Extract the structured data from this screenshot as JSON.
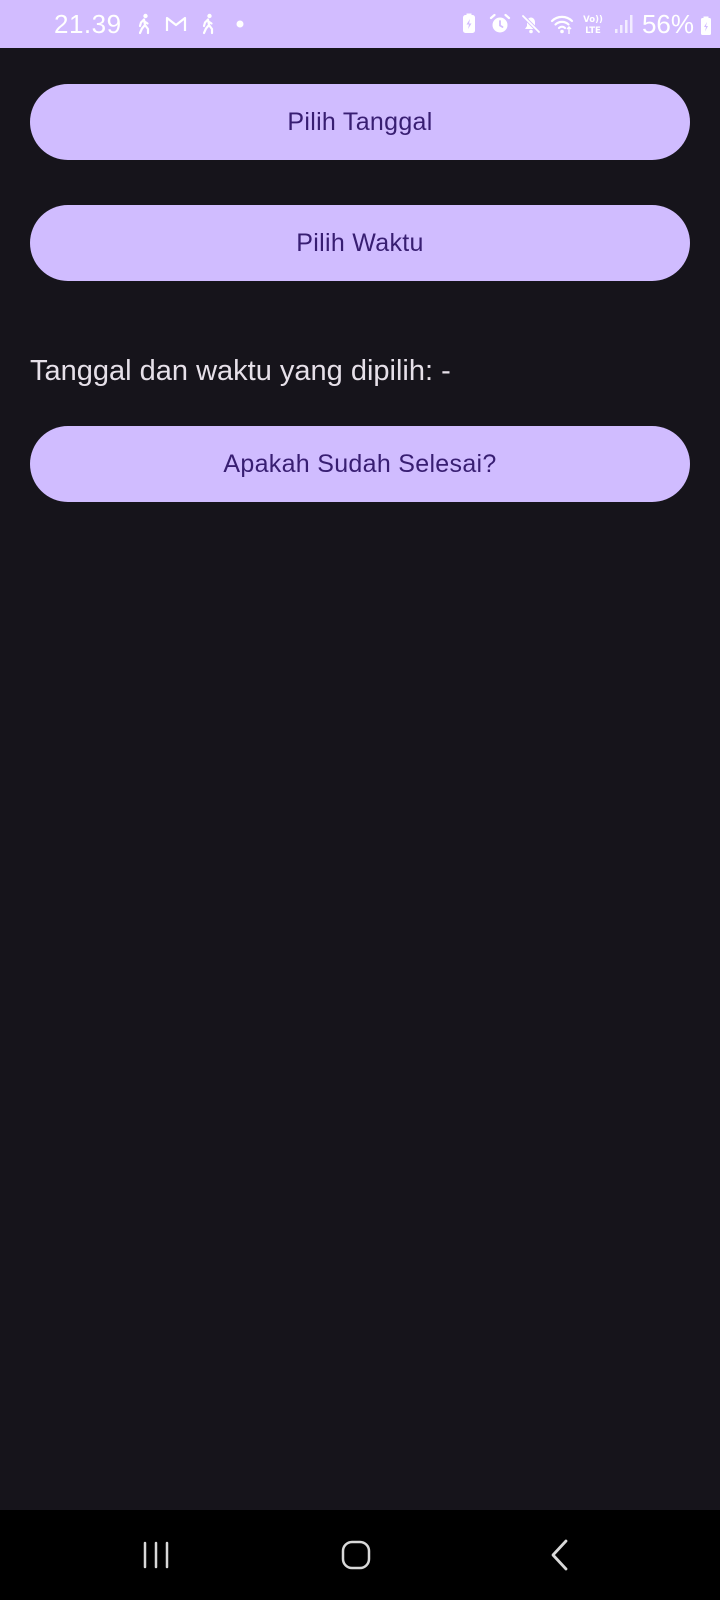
{
  "status_bar": {
    "time": "21.39",
    "battery_percent": "56%",
    "left_icons": [
      "walk-icon",
      "gmail-icon",
      "walk-icon",
      "dot-icon"
    ],
    "right_icons": [
      "battery-saver-icon",
      "alarm-icon",
      "mute-icon",
      "wifi-icon",
      "volte-icon",
      "signal-icon"
    ],
    "background_color": "#d2bcff"
  },
  "main": {
    "pick_date_label": "Pilih Tanggal",
    "pick_time_label": "Pilih Waktu",
    "selected_datetime_text": "Tanggal dan waktu yang dipilih: -",
    "done_label": "Apakah Sudah Selesai?"
  },
  "colors": {
    "background": "#16141b",
    "button_fill": "#d0bcff",
    "button_text": "#381e72",
    "body_text": "#e6e0e9"
  },
  "nav_bar": {
    "buttons": [
      "recents-icon",
      "home-icon",
      "back-icon"
    ]
  }
}
